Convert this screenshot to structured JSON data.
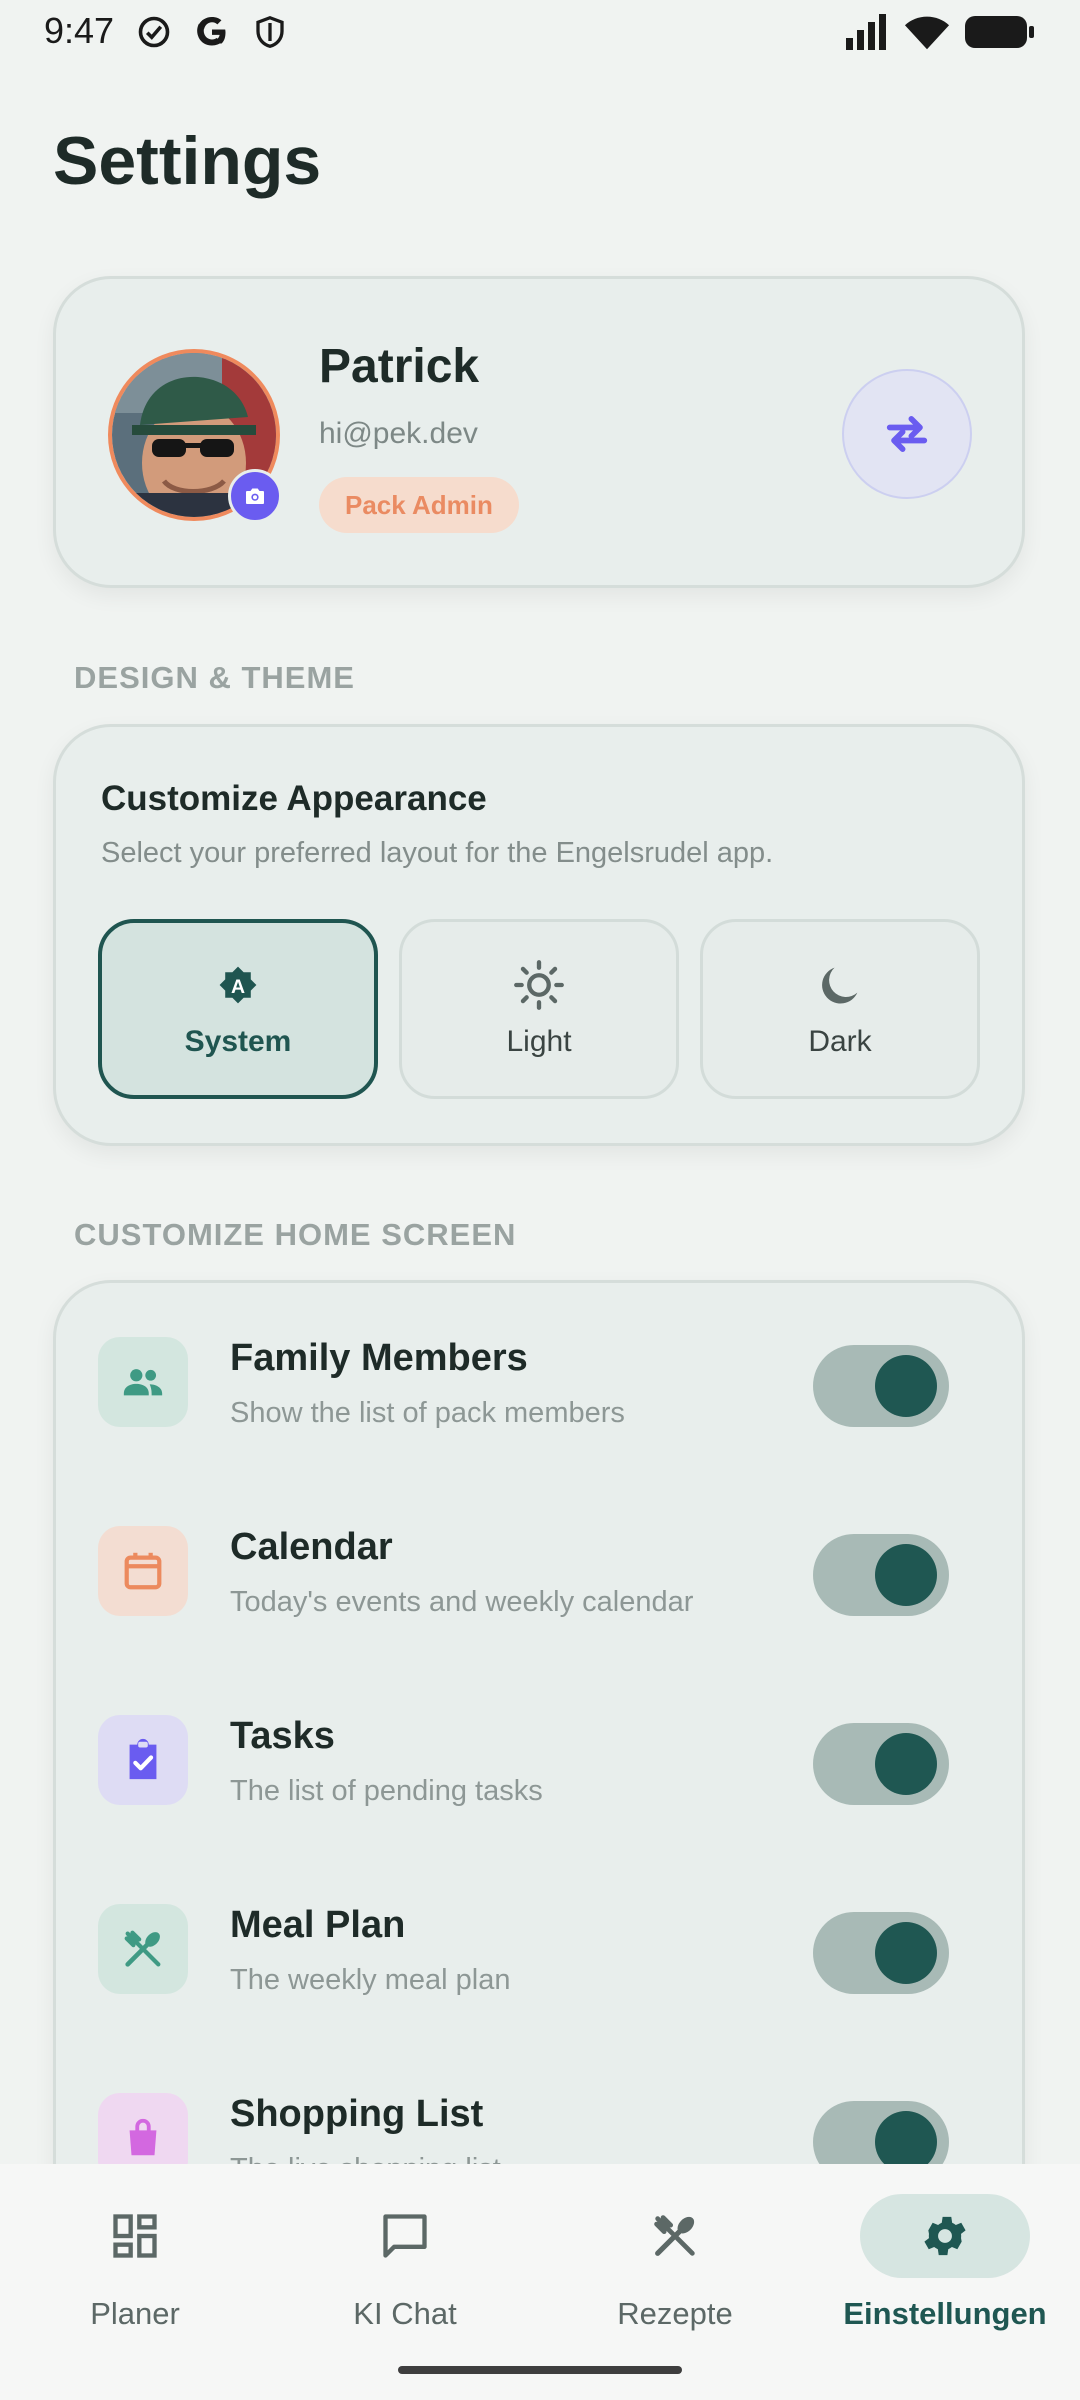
{
  "status_bar": {
    "time": "9:47"
  },
  "page": {
    "title": "Settings"
  },
  "profile": {
    "name": "Patrick",
    "email": "hi@pek.dev",
    "role": "Pack Admin"
  },
  "design_section": {
    "label": "DESIGN & THEME",
    "card_title": "Customize Appearance",
    "card_subtitle": "Select your preferred layout for the Engelsrudel app.",
    "options": [
      {
        "label": "System",
        "icon": "auto-theme-icon",
        "selected": true
      },
      {
        "label": "Light",
        "icon": "sun-icon",
        "selected": false
      },
      {
        "label": "Dark",
        "icon": "moon-icon",
        "selected": false
      }
    ]
  },
  "home_section": {
    "label": "CUSTOMIZE HOME SCREEN",
    "items": [
      {
        "title": "Family Members",
        "subtitle": "Show the list of pack members",
        "icon": "people-icon",
        "enabled": true
      },
      {
        "title": "Calendar",
        "subtitle": "Today's events and weekly calendar",
        "icon": "calendar-icon",
        "enabled": true
      },
      {
        "title": "Tasks",
        "subtitle": "The list of pending tasks",
        "icon": "clipboard-check-icon",
        "enabled": true
      },
      {
        "title": "Meal Plan",
        "subtitle": "The weekly meal plan",
        "icon": "utensils-icon",
        "enabled": true
      },
      {
        "title": "Shopping List",
        "subtitle": "The live shopping list",
        "icon": "shopping-bag-icon",
        "enabled": true
      }
    ]
  },
  "bottom_nav": {
    "items": [
      {
        "label": "Planer",
        "icon": "dashboard-icon",
        "active": false
      },
      {
        "label": "KI Chat",
        "icon": "chat-icon",
        "active": false
      },
      {
        "label": "Rezepte",
        "icon": "utensils-icon",
        "active": false
      },
      {
        "label": "Einstellungen",
        "icon": "gear-icon",
        "active": true
      }
    ]
  },
  "colors": {
    "primary": "#1f5752",
    "accent_orange": "#ea8b62",
    "accent_purple": "#6a5cf0",
    "background": "#f0f3f1"
  }
}
